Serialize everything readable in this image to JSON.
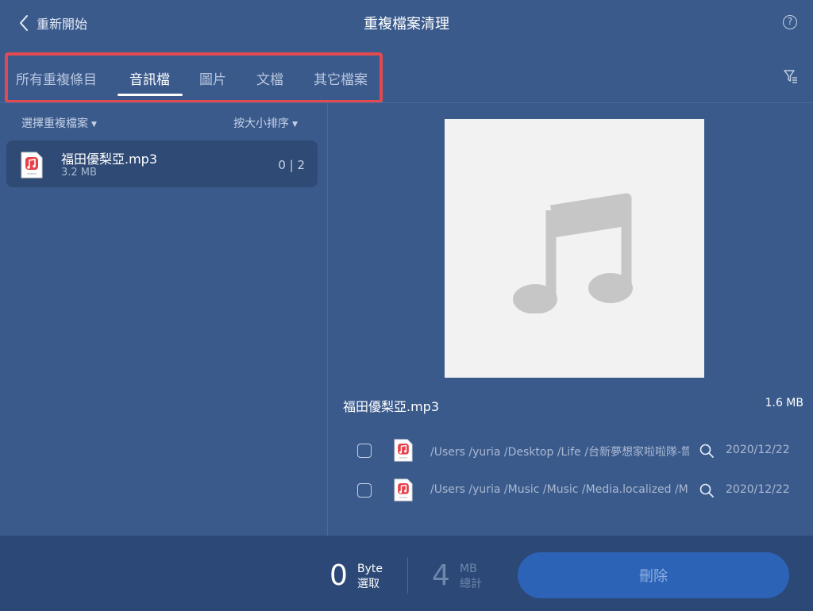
{
  "header": {
    "back_label": "重新開始",
    "title": "重複檔案清理",
    "help_glyph": "?"
  },
  "tabs": [
    {
      "label": "所有重複條目",
      "active": false
    },
    {
      "label": "音訊檔",
      "active": true
    },
    {
      "label": "圖片",
      "active": false
    },
    {
      "label": "文檔",
      "active": false
    },
    {
      "label": "其它檔案",
      "active": false
    }
  ],
  "left_pane": {
    "select_label": "選擇重複檔案",
    "sort_label": "按大小排序",
    "items": [
      {
        "name": "福田優梨亞.mp3",
        "size": "3.2 MB",
        "count": "0 | 2"
      }
    ]
  },
  "detail": {
    "file_name": "福田優梨亞.mp3",
    "file_size": "1.6 MB",
    "rows": [
      {
        "path": "/Users /yuria /Desktop /Life /台新夢想家啦啦隊-筒",
        "date": "2020/12/22",
        "checked": false
      },
      {
        "path": "/Users /yuria /Music /Music /Media.localized /Mu",
        "date": "2020/12/22",
        "checked": false
      }
    ]
  },
  "footer": {
    "selected_value": "0",
    "selected_unit": "Byte",
    "selected_label": "選取",
    "total_value": "4",
    "total_unit": "MB",
    "total_label": "總計",
    "delete_label": "刪除"
  },
  "icons": {
    "back": "chevron-left-icon",
    "help": "question-circle-icon",
    "filter": "filter-icon",
    "file": "mp3-file-icon",
    "music": "music-note-icon",
    "search": "magnifier-icon"
  },
  "colors": {
    "background": "#3a5a8c",
    "footer": "#2c4876",
    "highlight": "#e24a4f",
    "delete_button": "#2d63b6",
    "music_red": "#e8404a"
  }
}
